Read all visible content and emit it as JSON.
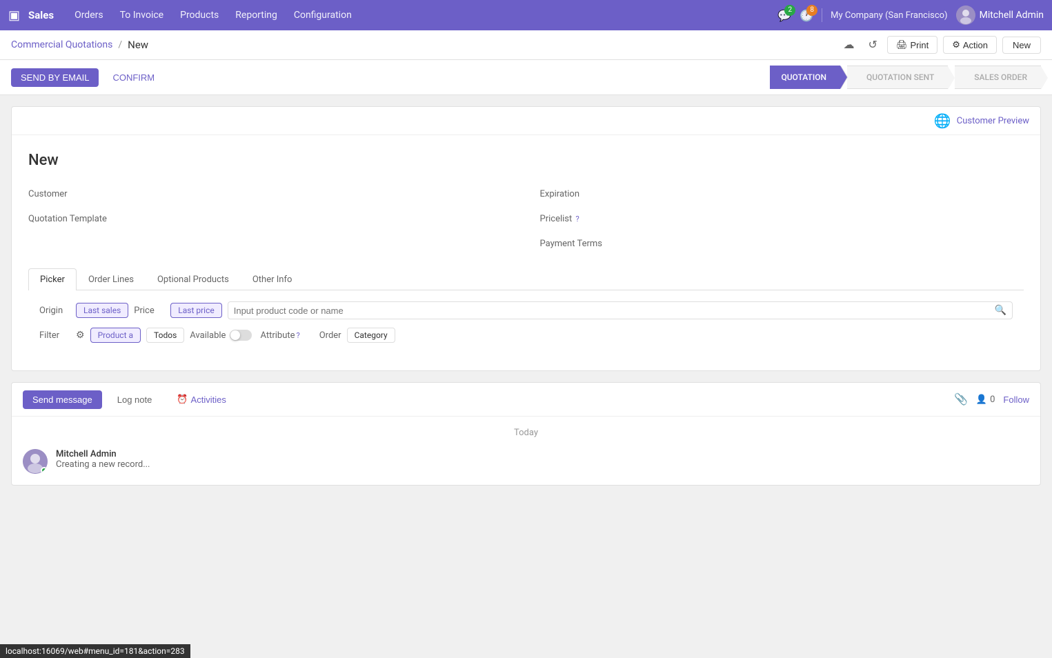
{
  "topnav": {
    "app_name": "Sales",
    "nav_items": [
      "Orders",
      "To Invoice",
      "Products",
      "Reporting",
      "Configuration"
    ],
    "msg_badge": "2",
    "clock_badge": "8",
    "company": "My Company (San Francisco)",
    "user": "Mitchell Admin"
  },
  "breadcrumb": {
    "link": "Commercial Quotations",
    "separator": "/",
    "current": "New",
    "print_label": "Print",
    "action_label": "Action",
    "new_label": "New"
  },
  "status_bar": {
    "send_email": "SEND BY EMAIL",
    "confirm": "CONFIRM",
    "steps": [
      {
        "label": "QUOTATION",
        "active": true
      },
      {
        "label": "QUOTATION SENT",
        "active": false
      },
      {
        "label": "SALES ORDER",
        "active": false
      }
    ]
  },
  "customer_preview": {
    "label": "Customer Preview"
  },
  "form": {
    "title": "New",
    "fields": {
      "customer_label": "Customer",
      "quotation_template_label": "Quotation Template",
      "expiration_label": "Expiration",
      "pricelist_label": "Pricelist",
      "payment_terms_label": "Payment Terms"
    }
  },
  "tabs": [
    {
      "label": "Picker",
      "active": true
    },
    {
      "label": "Order Lines",
      "active": false
    },
    {
      "label": "Optional Products",
      "active": false
    },
    {
      "label": "Other Info",
      "active": false
    }
  ],
  "picker": {
    "origin_label": "Origin",
    "last_sales_chip": "Last sales",
    "price_label": "Price",
    "last_price_chip": "Last price",
    "search_placeholder": "Input product code or name",
    "filter_label": "Filter",
    "product_chip": "Product a",
    "todos_chip": "Todos",
    "available_label": "Available",
    "attribute_label": "Attribute",
    "attribute_help": "?",
    "order_label": "Order",
    "category_chip": "Category"
  },
  "messages": {
    "send_message_label": "Send message",
    "log_note_label": "Log note",
    "activities_label": "Activities",
    "followers_count": "0",
    "follow_label": "Follow"
  },
  "timeline": {
    "date_label": "Today",
    "author": "Mitchell Admin",
    "text": "Creating a new record..."
  },
  "url_bar": "localhost:16069/web#menu_id=181&action=283"
}
